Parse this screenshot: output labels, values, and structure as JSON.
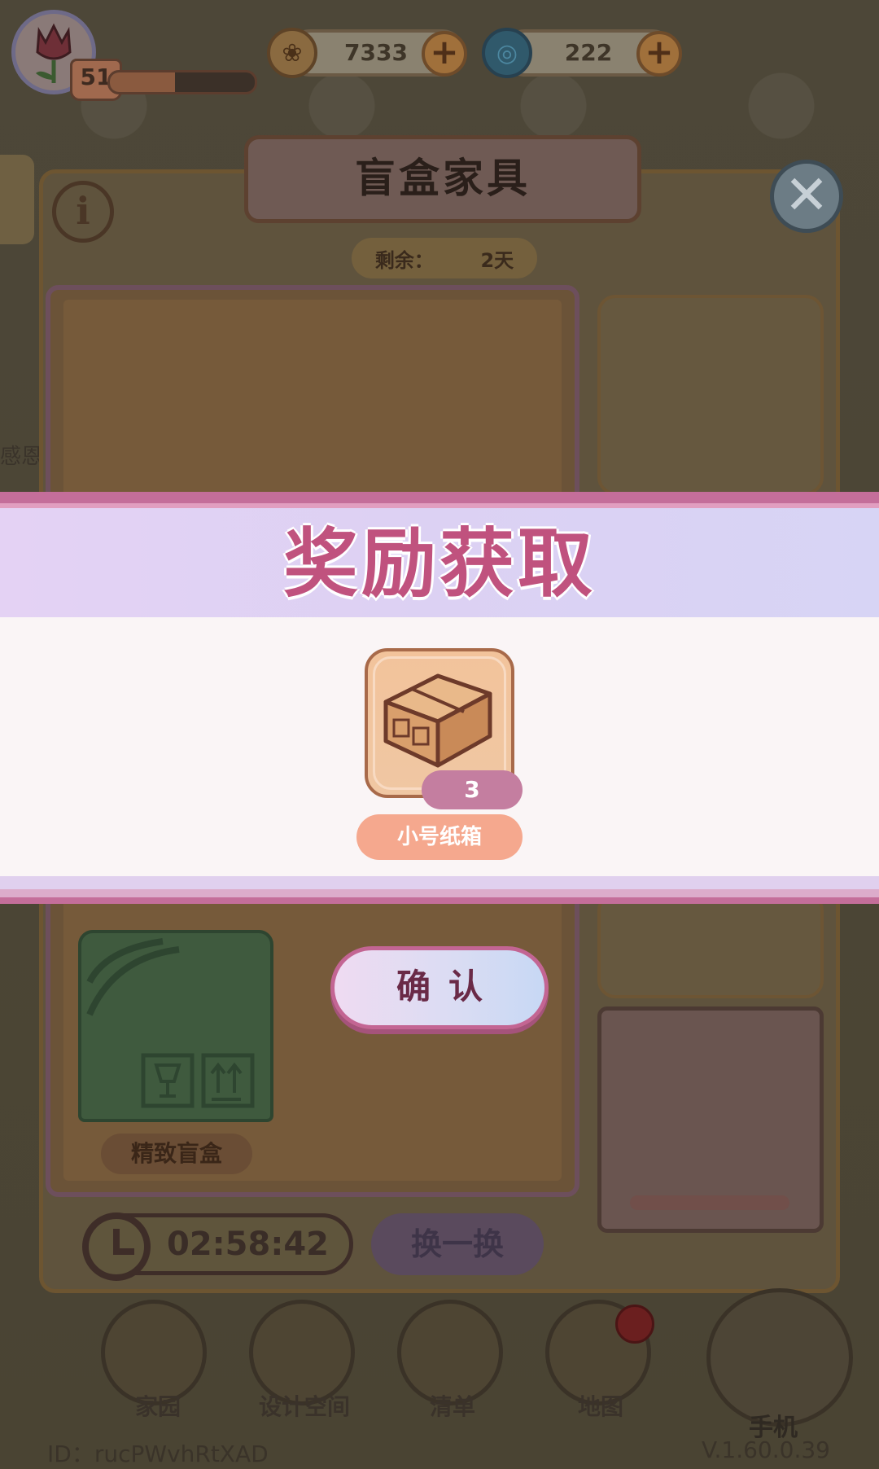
{
  "hud": {
    "level": "51",
    "level_progress": 0.45,
    "coins": "7333",
    "gems": "222",
    "plus_label": "+"
  },
  "panel": {
    "title": "盲盒家具",
    "info_symbol": "i",
    "close_symbol": "✕",
    "remain_label": "剩余：",
    "remain_value": "2天",
    "green_box_label": "精致盲盒",
    "timer": "02:58:42",
    "swap_label": "换一换"
  },
  "side": {
    "left_text": "感恩"
  },
  "reward": {
    "title": "奖励获取",
    "item_count": "3",
    "item_name": "小号纸箱",
    "confirm_label": "确认"
  },
  "nav": {
    "items": [
      "家园",
      "设计空间",
      "清单",
      "地图"
    ],
    "phone_label": "手机"
  },
  "footer": {
    "id": "ID：rucPWvhRtXAD",
    "version": "V.1.60.0.39"
  },
  "colors": {
    "banner_title": "#c0527e",
    "accent_pink": "#c46e9a",
    "item_name_bg": "#f5a88e"
  }
}
